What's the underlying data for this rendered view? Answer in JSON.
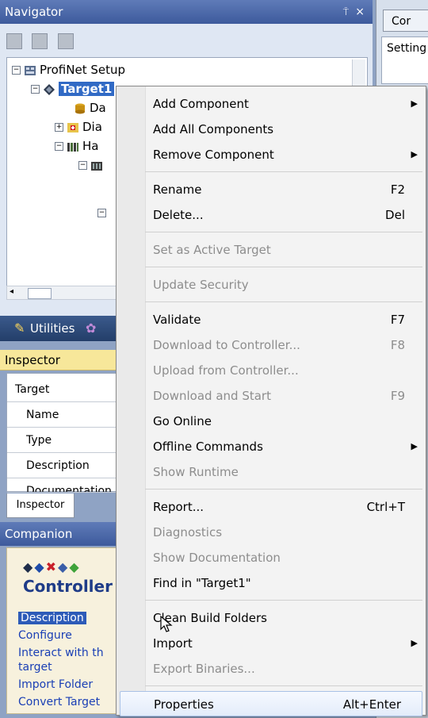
{
  "navigator": {
    "title": "Navigator",
    "pin": "⍑",
    "close": "×",
    "tree": [
      {
        "label": "ProfiNet Setup",
        "expander": "−"
      },
      {
        "label": "Target1",
        "expander": "−",
        "selected": true
      },
      {
        "label": "Da"
      },
      {
        "label": "Dia",
        "expander": "+"
      },
      {
        "label": "Ha",
        "expander": "−"
      },
      {
        "label": "",
        "expander": "−"
      },
      {
        "label": "",
        "expander": "−"
      }
    ]
  },
  "utilities": {
    "label": "Utilities"
  },
  "inspector": {
    "title": "Inspector",
    "rows": [
      "Target",
      "Name",
      "Type",
      "Description",
      "Documentation"
    ],
    "tab": "Inspector"
  },
  "companion": {
    "title": "Companion",
    "controller_title": "Controller T",
    "links": [
      "Description",
      "Configure",
      "Interact with th",
      "target",
      "Import Folder",
      "Convert Target"
    ]
  },
  "right_panel": {
    "tab": "Cor",
    "settings": "Setting"
  },
  "menu": {
    "items": [
      {
        "label": "Add Component",
        "shortcut": "",
        "submenu": true,
        "disabled": false
      },
      {
        "label": "Add All Components",
        "shortcut": "",
        "submenu": false,
        "disabled": false
      },
      {
        "label": "Remove Component",
        "shortcut": "",
        "submenu": true,
        "disabled": false
      },
      {
        "label": "Rename",
        "shortcut": "F2",
        "submenu": false,
        "disabled": false
      },
      {
        "label": "Delete...",
        "shortcut": "Del",
        "submenu": false,
        "disabled": false
      },
      {
        "label": "Set as Active Target",
        "shortcut": "",
        "submenu": false,
        "disabled": true
      },
      {
        "label": "Update Security",
        "shortcut": "",
        "submenu": false,
        "disabled": true
      },
      {
        "label": "Validate",
        "shortcut": "F7",
        "submenu": false,
        "disabled": false
      },
      {
        "label": "Download to Controller...",
        "shortcut": "F8",
        "submenu": false,
        "disabled": true
      },
      {
        "label": "Upload from Controller...",
        "shortcut": "",
        "submenu": false,
        "disabled": true
      },
      {
        "label": "Download and Start",
        "shortcut": "F9",
        "submenu": false,
        "disabled": true
      },
      {
        "label": "Go Online",
        "shortcut": "",
        "submenu": false,
        "disabled": false
      },
      {
        "label": "Offline Commands",
        "shortcut": "",
        "submenu": true,
        "disabled": false
      },
      {
        "label": "Show Runtime",
        "shortcut": "",
        "submenu": false,
        "disabled": true
      },
      {
        "label": "Report...",
        "shortcut": "Ctrl+T",
        "submenu": false,
        "disabled": false
      },
      {
        "label": "Diagnostics",
        "shortcut": "",
        "submenu": false,
        "disabled": true
      },
      {
        "label": "Show Documentation",
        "shortcut": "",
        "submenu": false,
        "disabled": true
      },
      {
        "label": "Find in \"Target1\"",
        "shortcut": "",
        "submenu": false,
        "disabled": false
      },
      {
        "label": "Clean Build Folders",
        "shortcut": "",
        "submenu": false,
        "disabled": false
      },
      {
        "label": "Import",
        "shortcut": "",
        "submenu": true,
        "disabled": false
      },
      {
        "label": "Export Binaries...",
        "shortcut": "",
        "submenu": false,
        "disabled": true
      },
      {
        "label": "Properties",
        "shortcut": "Alt+Enter",
        "submenu": false,
        "disabled": false,
        "hover": true
      }
    ]
  },
  "colors": {
    "selection": "#316ac5",
    "menu_bg": "#f3f3f3",
    "disabled_text": "#8d8d8d",
    "link": "#1a3fb5"
  }
}
